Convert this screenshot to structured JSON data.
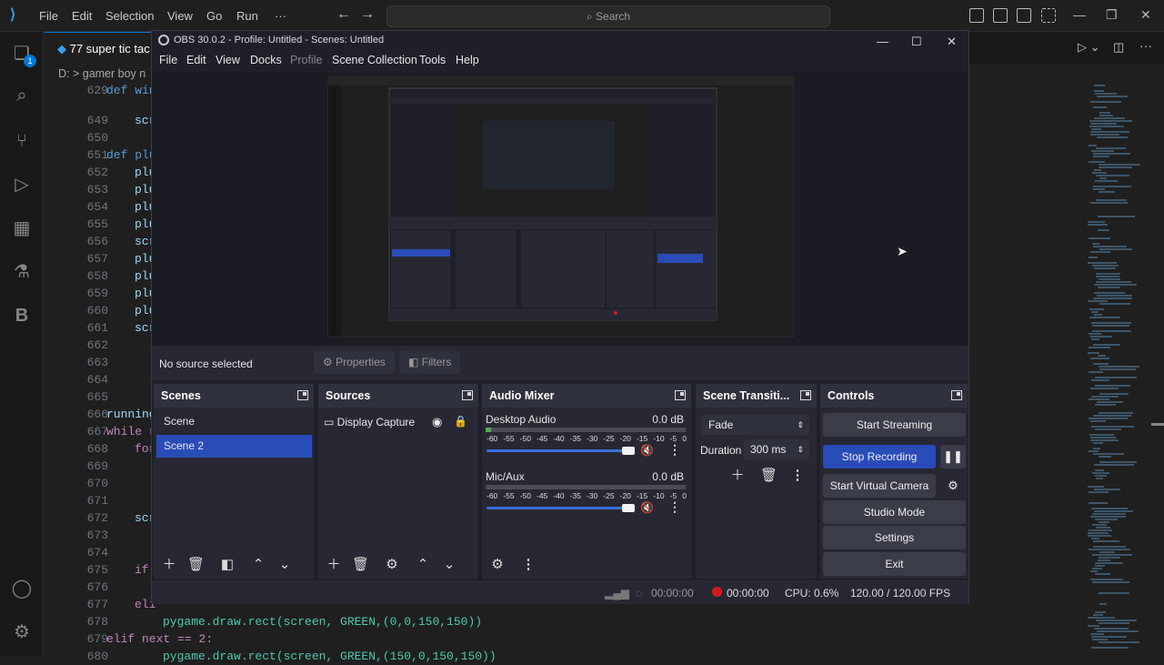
{
  "vscode": {
    "menu": [
      "File",
      "Edit",
      "Selection",
      "View",
      "Go",
      "Run",
      "···"
    ],
    "search_placeholder": "Search",
    "tab_title": "77 super tic tac",
    "breadcrumb": "D: > gamer boy n",
    "extension_badge": "1",
    "lines": [
      {
        "n": "629",
        "t": "def win"
      },
      {
        "n": "",
        "t": "scr"
      },
      {
        "n": "649",
        "t": "scr"
      },
      {
        "n": "650",
        "t": ""
      },
      {
        "n": "651",
        "t": "def plu"
      },
      {
        "n": "652",
        "t": "plu"
      },
      {
        "n": "653",
        "t": "plu"
      },
      {
        "n": "654",
        "t": "plu"
      },
      {
        "n": "655",
        "t": "plu"
      },
      {
        "n": "656",
        "t": "scr"
      },
      {
        "n": "657",
        "t": "plu"
      },
      {
        "n": "658",
        "t": "plu"
      },
      {
        "n": "659",
        "t": "plu"
      },
      {
        "n": "660",
        "t": "plu"
      },
      {
        "n": "661",
        "t": "scr"
      },
      {
        "n": "662",
        "t": ""
      },
      {
        "n": "663",
        "t": ""
      },
      {
        "n": "664",
        "t": ""
      },
      {
        "n": "665",
        "t": ""
      },
      {
        "n": "666",
        "t": "running"
      },
      {
        "n": "667",
        "t": "while r"
      },
      {
        "n": "668",
        "t": "for"
      },
      {
        "n": "669",
        "t": ""
      },
      {
        "n": "670",
        "t": ""
      },
      {
        "n": "671",
        "t": ""
      },
      {
        "n": "672",
        "t": "scr"
      },
      {
        "n": "673",
        "t": ""
      },
      {
        "n": "674",
        "t": ""
      },
      {
        "n": "675",
        "t": "if"
      },
      {
        "n": "676",
        "t": ""
      },
      {
        "n": "677",
        "t": "eli"
      },
      {
        "n": "678",
        "t": "pygame.draw.rect(screen, GREEN,(0,0,150,150))"
      },
      {
        "n": "679",
        "t": "elif next == 2:"
      },
      {
        "n": "680",
        "t": "pygame.draw.rect(screen, GREEN,(150,0,150,150))"
      }
    ]
  },
  "obs": {
    "title": "OBS 30.0.2 - Profile: Untitled - Scenes: Untitled",
    "menu": [
      "File",
      "Edit",
      "View",
      "Docks",
      "Profile",
      "Scene Collection",
      "Tools",
      "Help"
    ],
    "no_source": "No source selected",
    "properties": "Properties",
    "filters": "Filters",
    "scenes": {
      "title": "Scenes",
      "items": [
        "Scene",
        "Scene 2"
      ]
    },
    "sources": {
      "title": "Sources",
      "items": [
        "Display Capture"
      ]
    },
    "mixer": {
      "title": "Audio Mixer",
      "channels": [
        {
          "name": "Desktop Audio",
          "db": "0.0 dB"
        },
        {
          "name": "Mic/Aux",
          "db": "0.0 dB"
        }
      ],
      "scale": [
        "-60",
        "-55",
        "-50",
        "-45",
        "-40",
        "-35",
        "-30",
        "-25",
        "-20",
        "-15",
        "-10",
        "-5",
        "0"
      ]
    },
    "transitions": {
      "title": "Scene Transiti...",
      "type": "Fade",
      "duration_label": "Duration",
      "duration": "300 ms"
    },
    "controls": {
      "title": "Controls",
      "start_streaming": "Start Streaming",
      "stop_recording": "Stop Recording",
      "start_virtual_camera": "Start Virtual Camera",
      "studio_mode": "Studio Mode",
      "settings": "Settings",
      "exit": "Exit"
    },
    "status": {
      "stream_time": "00:00:00",
      "rec_time": "00:00:00",
      "cpu": "CPU: 0.6%",
      "fps": "120.00 / 120.00 FPS"
    }
  }
}
